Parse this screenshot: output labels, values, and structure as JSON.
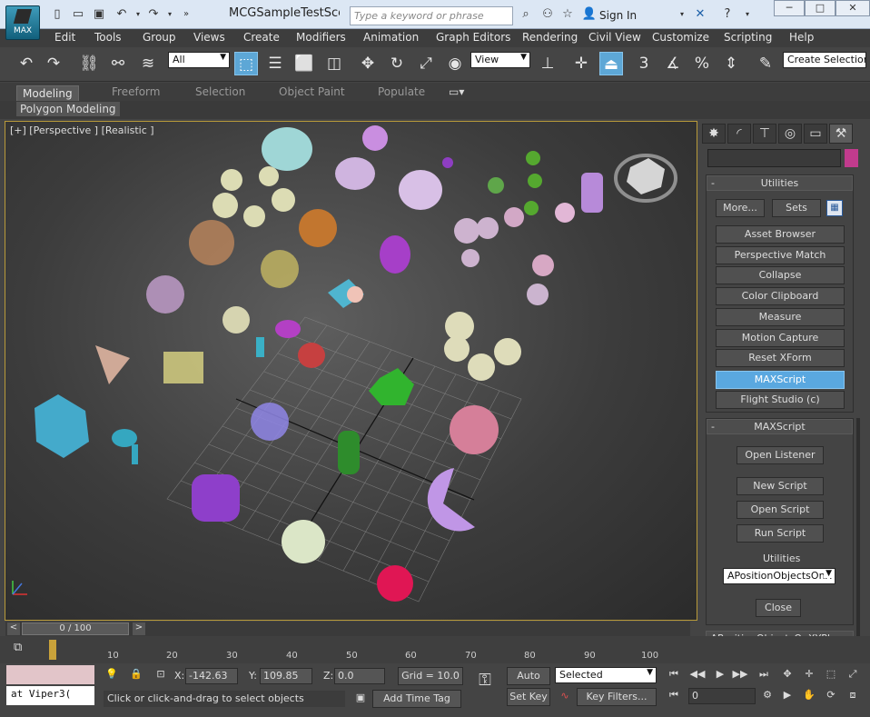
{
  "app": {
    "title": "MCGSampleTestSce...",
    "logo_text": "MAX"
  },
  "search": {
    "placeholder": "Type a keyword or phrase"
  },
  "account": {
    "signin": "Sign In"
  },
  "menu": [
    "Edit",
    "Tools",
    "Group",
    "Views",
    "Create",
    "Modifiers",
    "Animation",
    "Graph Editors",
    "Rendering",
    "Civil View",
    "Customize",
    "Scripting",
    "Help"
  ],
  "toolbar": {
    "filter_value": "All",
    "refcoord_value": "View",
    "create_selection": "Create Selection S",
    "snap_3": "3",
    "snap_pct": "%",
    "icons": [
      "undo-icon",
      "redo-icon",
      "link-icon",
      "unlink-icon",
      "bind-spacewarp-icon",
      "select-object-icon",
      "select-by-name-icon",
      "rect-region-icon",
      "window-crossing-icon",
      "move-icon",
      "rotate-icon",
      "scale-icon",
      "placement-icon",
      "pivot-icon",
      "manipulate-icon",
      "snap-toggle-icon",
      "angle-snap-icon",
      "percent-snap-icon",
      "spinner-snap-icon",
      "named-selection-icon"
    ]
  },
  "ribbon": {
    "tabs": [
      "Modeling",
      "Freeform",
      "Selection",
      "Object Paint",
      "Populate"
    ],
    "active": "Modeling",
    "sub": "Polygon Modeling"
  },
  "viewport": {
    "label": "[+] [Perspective ] [Realistic ]"
  },
  "panel": {
    "utilities_title": "Utilities",
    "more": "More...",
    "sets": "Sets",
    "buttons": [
      "Asset Browser",
      "Perspective Match",
      "Collapse",
      "Color Clipboard",
      "Measure",
      "Motion Capture",
      "Reset XForm",
      "MAXScript",
      "Flight Studio (c)"
    ],
    "active_button": "MAXScript",
    "maxscript_title": "MAXScript",
    "open_listener": "Open Listener",
    "new_script": "New Script",
    "open_script": "Open Script",
    "run_script": "Run Script",
    "utilities_label": "Utilities",
    "utilities_value": "APositionObjectsOnX",
    "close": "Close",
    "bottom_rollout": "APositionObjectsOnXYPlane",
    "collapse_mark": "-",
    "colors": {
      "swatch": "#c13b8d",
      "active": "#5aa8e0"
    }
  },
  "timeline": {
    "frame": "0 / 100",
    "ticks": [
      "10",
      "20",
      "30",
      "40",
      "50",
      "60",
      "70",
      "80",
      "90",
      "100"
    ],
    "prev": "<",
    "next": ">"
  },
  "status": {
    "listener_text": "at Viper3(",
    "prompt": "Click or click-and-drag to select objects",
    "x_label": "X:",
    "x_value": "-142.63",
    "y_label": "Y:",
    "y_value": "109.85",
    "z_label": "Z:",
    "z_value": "0.0",
    "grid": "Grid = 10.0",
    "add_time_tag": "Add Time Tag",
    "auto_key": "Auto Key",
    "selected": "Selected",
    "set_key": "Set Key",
    "key_filters": "Key Filters...",
    "frame_value": "0"
  }
}
